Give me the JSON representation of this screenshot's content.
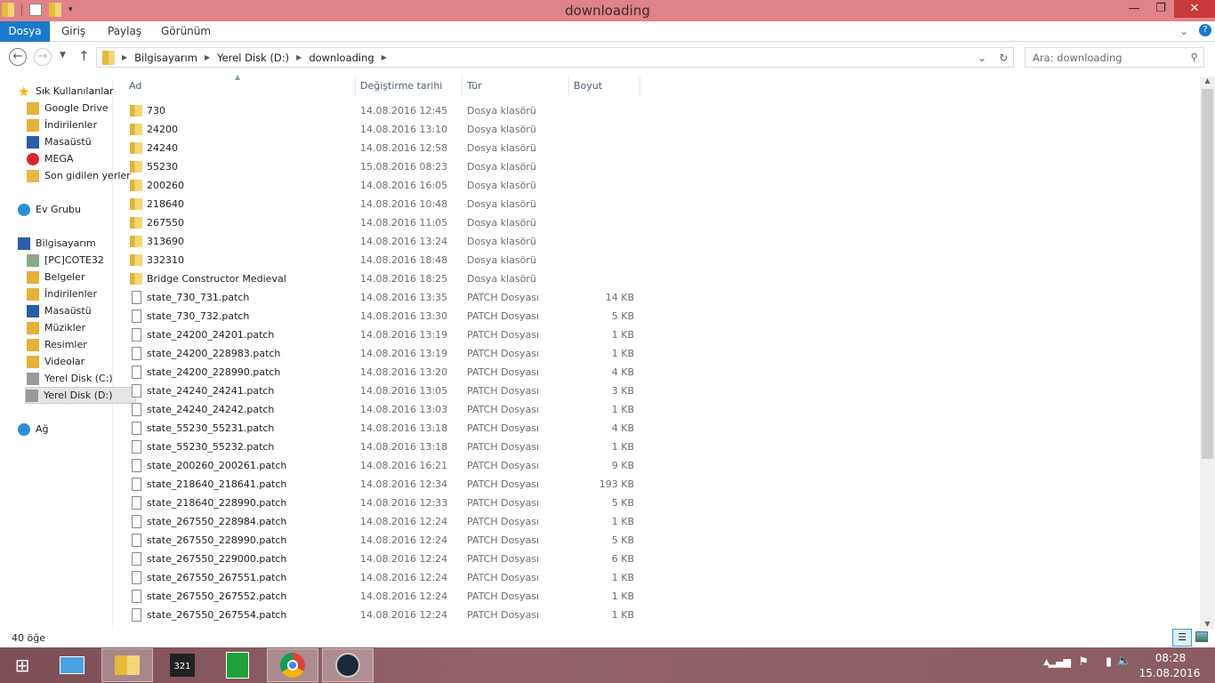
{
  "window": {
    "title": "downloading"
  },
  "ribbon": {
    "tabs": [
      "Dosya",
      "Giriş",
      "Paylaş",
      "Görünüm"
    ]
  },
  "address": {
    "crumbs": [
      "Bilgisayarım",
      "Yerel Disk (D:)",
      "downloading"
    ],
    "search_placeholder": "Ara: downloading"
  },
  "sidebar": {
    "items": [
      {
        "label": "Sık Kullanılanlar",
        "icon": "star-icon"
      },
      {
        "label": "Google Drive",
        "icon": "folder-icon"
      },
      {
        "label": "İndirilenler",
        "icon": "downloads-icon"
      },
      {
        "label": "Masaüstü",
        "icon": "desktop-icon"
      },
      {
        "label": "MEGA",
        "icon": "mega-icon"
      },
      {
        "label": "Son gidilen yerler",
        "icon": "recent-icon"
      },
      {
        "label": "Ev Grubu",
        "icon": "homegroup-icon"
      },
      {
        "label": "Bilgisayarım",
        "icon": "computer-icon"
      },
      {
        "label": "[PC]COTE32",
        "icon": "network-drive-icon"
      },
      {
        "label": "Belgeler",
        "icon": "documents-icon"
      },
      {
        "label": "İndirilenler",
        "icon": "downloads-icon"
      },
      {
        "label": "Masaüstü",
        "icon": "desktop-icon"
      },
      {
        "label": "Müzikler",
        "icon": "music-icon"
      },
      {
        "label": "Resimler",
        "icon": "pictures-icon"
      },
      {
        "label": "Videolar",
        "icon": "videos-icon"
      },
      {
        "label": "Yerel Disk (C:)",
        "icon": "drive-icon"
      },
      {
        "label": "Yerel Disk (D:)",
        "icon": "drive-icon"
      },
      {
        "label": "Ağ",
        "icon": "network-icon"
      }
    ]
  },
  "columns": [
    "Ad",
    "Değiştirme tarihi",
    "Tür",
    "Boyut"
  ],
  "files": [
    {
      "name": "730",
      "date": "14.08.2016 12:45",
      "type": "Dosya klasörü",
      "size": "",
      "folder": true
    },
    {
      "name": "24200",
      "date": "14.08.2016 13:10",
      "type": "Dosya klasörü",
      "size": "",
      "folder": true
    },
    {
      "name": "24240",
      "date": "14.08.2016 12:58",
      "type": "Dosya klasörü",
      "size": "",
      "folder": true
    },
    {
      "name": "55230",
      "date": "15.08.2016 08:23",
      "type": "Dosya klasörü",
      "size": "",
      "folder": true
    },
    {
      "name": "200260",
      "date": "14.08.2016 16:05",
      "type": "Dosya klasörü",
      "size": "",
      "folder": true
    },
    {
      "name": "218640",
      "date": "14.08.2016 10:48",
      "type": "Dosya klasörü",
      "size": "",
      "folder": true
    },
    {
      "name": "267550",
      "date": "14.08.2016 11:05",
      "type": "Dosya klasörü",
      "size": "",
      "folder": true
    },
    {
      "name": "313690",
      "date": "14.08.2016 13:24",
      "type": "Dosya klasörü",
      "size": "",
      "folder": true
    },
    {
      "name": "332310",
      "date": "14.08.2016 18:48",
      "type": "Dosya klasörü",
      "size": "",
      "folder": true
    },
    {
      "name": "Bridge Constructor Medieval",
      "date": "14.08.2016 18:25",
      "type": "Dosya klasörü",
      "size": "",
      "folder": true
    },
    {
      "name": "state_730_731.patch",
      "date": "14.08.2016 13:35",
      "type": "PATCH Dosyası",
      "size": "14 KB"
    },
    {
      "name": "state_730_732.patch",
      "date": "14.08.2016 13:30",
      "type": "PATCH Dosyası",
      "size": "5 KB"
    },
    {
      "name": "state_24200_24201.patch",
      "date": "14.08.2016 13:19",
      "type": "PATCH Dosyası",
      "size": "1 KB"
    },
    {
      "name": "state_24200_228983.patch",
      "date": "14.08.2016 13:19",
      "type": "PATCH Dosyası",
      "size": "1 KB"
    },
    {
      "name": "state_24200_228990.patch",
      "date": "14.08.2016 13:20",
      "type": "PATCH Dosyası",
      "size": "4 KB"
    },
    {
      "name": "state_24240_24241.patch",
      "date": "14.08.2016 13:05",
      "type": "PATCH Dosyası",
      "size": "3 KB"
    },
    {
      "name": "state_24240_24242.patch",
      "date": "14.08.2016 13:03",
      "type": "PATCH Dosyası",
      "size": "1 KB"
    },
    {
      "name": "state_55230_55231.patch",
      "date": "14.08.2016 13:18",
      "type": "PATCH Dosyası",
      "size": "4 KB"
    },
    {
      "name": "state_55230_55232.patch",
      "date": "14.08.2016 13:18",
      "type": "PATCH Dosyası",
      "size": "1 KB"
    },
    {
      "name": "state_200260_200261.patch",
      "date": "14.08.2016 16:21",
      "type": "PATCH Dosyası",
      "size": "9 KB"
    },
    {
      "name": "state_218640_218641.patch",
      "date": "14.08.2016 12:34",
      "type": "PATCH Dosyası",
      "size": "193 KB"
    },
    {
      "name": "state_218640_228990.patch",
      "date": "14.08.2016 12:33",
      "type": "PATCH Dosyası",
      "size": "5 KB"
    },
    {
      "name": "state_267550_228984.patch",
      "date": "14.08.2016 12:24",
      "type": "PATCH Dosyası",
      "size": "1 KB"
    },
    {
      "name": "state_267550_228990.patch",
      "date": "14.08.2016 12:24",
      "type": "PATCH Dosyası",
      "size": "5 KB"
    },
    {
      "name": "state_267550_229000.patch",
      "date": "14.08.2016 12:24",
      "type": "PATCH Dosyası",
      "size": "6 KB"
    },
    {
      "name": "state_267550_267551.patch",
      "date": "14.08.2016 12:24",
      "type": "PATCH Dosyası",
      "size": "1 KB"
    },
    {
      "name": "state_267550_267552.patch",
      "date": "14.08.2016 12:24",
      "type": "PATCH Dosyası",
      "size": "1 KB"
    },
    {
      "name": "state_267550_267554.patch",
      "date": "14.08.2016 12:24",
      "type": "PATCH Dosyası",
      "size": "1 KB"
    }
  ],
  "status": {
    "count": "40 öğe"
  },
  "tray": {
    "time": "08:28",
    "date": "15.08.2016"
  }
}
